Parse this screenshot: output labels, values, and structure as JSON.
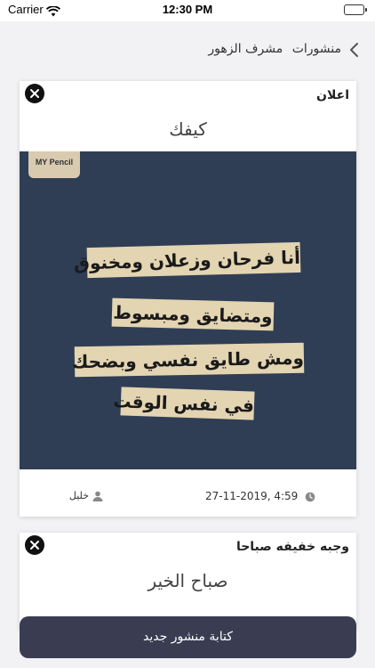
{
  "status_bar": {
    "carrier": "Carrier",
    "time": "12:30 PM"
  },
  "nav": {
    "back_icon": "chevron-left-icon",
    "title_section": "منشورات",
    "title_name": "مشرف الزهور"
  },
  "posts": [
    {
      "title": "اعلان",
      "subtitle": "كيفك",
      "image": {
        "brand": "MY Pencil",
        "lines": [
          "أنا فرحان وزعلان ومخنوق",
          "ومتضايق ومبسوط",
          "ومش طايق نفسي وبضحك",
          "في نفس الوقت"
        ],
        "background": "#2f3e54",
        "strip_color": "#e3d4b2"
      },
      "author": "خليل",
      "timestamp": "27-11-2019, 4:59"
    },
    {
      "title": "وجبه خفيفه صباحا",
      "subtitle": "صباح الخير"
    }
  ],
  "compose_button": "كتابة منشور جديد",
  "colors": {
    "accent": "#3a3d52",
    "battery": "#3ec74a"
  }
}
